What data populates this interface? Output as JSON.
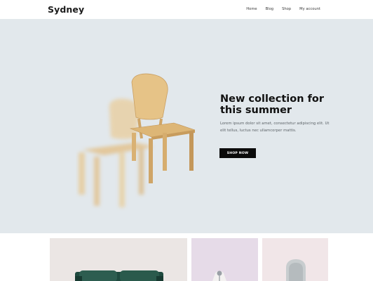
{
  "site": {
    "title": "Sydney"
  },
  "nav": {
    "items": [
      "Home",
      "Blog",
      "Shop",
      "My account"
    ]
  },
  "hero": {
    "title": "New collection for this summer",
    "text": "Lorem ipsum dolor sit amet, consectetur adipiscing elit. Ut elit tellus, luctus nec ullamcorper mattis.",
    "button_label": "SHOP NOW",
    "image": "wooden-chair-image"
  },
  "products": [
    {
      "image": "green-sofa-image"
    },
    {
      "image": "lamp-image"
    },
    {
      "image": "armchair-image"
    }
  ],
  "colors": {
    "hero_bg": "#e2e8ec",
    "button_bg": "#0b0b0b",
    "text": "#1c1c1c"
  }
}
